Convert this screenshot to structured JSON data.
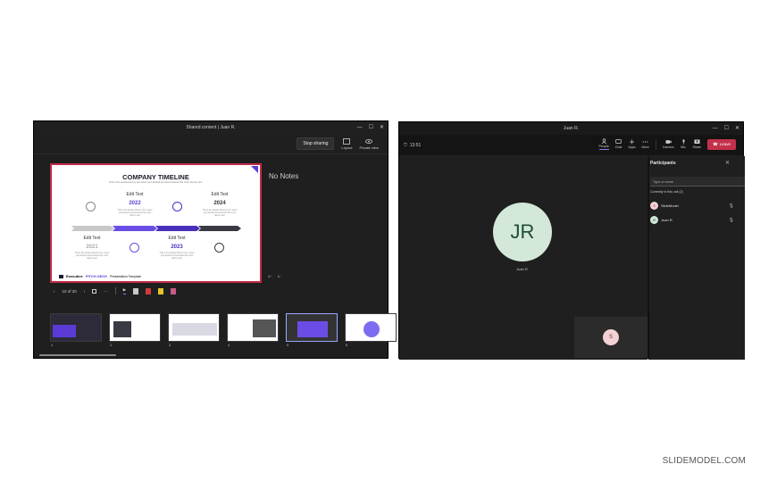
{
  "left_window": {
    "title": "Shared content | Juan R.",
    "stop_sharing": "Stop sharing",
    "toolbar": {
      "layout": "Layout",
      "private_view": "Private view"
    },
    "notes": "No Notes",
    "font_increase": "A⁺",
    "font_decrease": "A⁻",
    "slide_counter": "10 of 20",
    "slide": {
      "title": "COMPANY TIMELINE",
      "subtitle": "This is the sample dummy text insert your desired text here because this is the dummy text.",
      "milestones": [
        {
          "label": "Edit Text",
          "year": "2021",
          "text": "This is the sample Dummy Text. Insert your desired text because this is the dummy text"
        },
        {
          "label": "Edit Text",
          "year": "2022",
          "text": "This is the sample Dummy Text. Insert your desired text because this is the dummy text"
        },
        {
          "label": "Edit Text",
          "year": "2023",
          "text": "This is the sample Dummy Text. Insert your desired text because this is the dummy text"
        },
        {
          "label": "Edit Text",
          "year": "2024",
          "text": "This is the sample Dummy Text. Insert your desired text because this is the dummy text"
        }
      ],
      "footer_brand": "Executive",
      "footer_brand2": "PITCH DECK",
      "footer_caption": "Presentation Template"
    },
    "thumbnails": [
      "1",
      "2",
      "3",
      "4",
      "5",
      "6"
    ]
  },
  "right_window": {
    "title": "Juan R.",
    "time": "13:51",
    "tools": [
      "People",
      "Chat",
      "Apps",
      "More",
      "Camera",
      "Mic",
      "Share"
    ],
    "leave": "Leave",
    "main_avatar": {
      "initials": "JR",
      "name": "Juan R."
    },
    "self_avatar": "S",
    "panel": {
      "title": "Participants",
      "search_placeholder": "Type a name",
      "section": "Currently in this call (2)",
      "participants": [
        {
          "initials": "S",
          "name": "SlideModel"
        },
        {
          "initials": "JR",
          "name": "Juan R."
        }
      ]
    }
  },
  "brand": "SLIDEMODEL.COM",
  "colors": {
    "accent": "#5b3bd6",
    "leave": "#c4314b",
    "slide_border": "#c22a4a"
  }
}
